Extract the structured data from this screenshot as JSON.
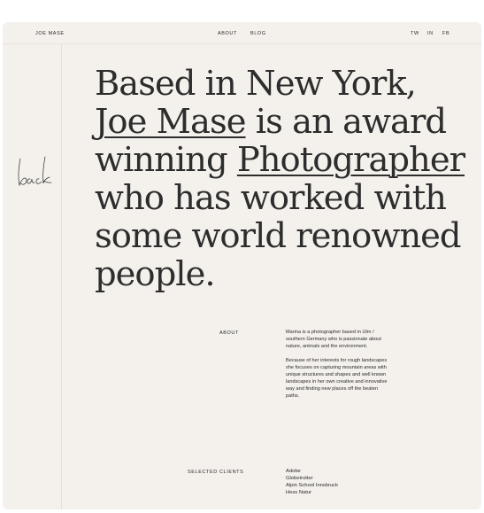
{
  "header": {
    "brand": "JOE MASE",
    "nav": {
      "about": "ABOUT",
      "blog": "BLOG"
    },
    "social": {
      "tw": "TW",
      "in": "IN",
      "fb": "FB"
    }
  },
  "sidebar": {
    "back_label": "back"
  },
  "hero": {
    "line1": "Based in New York,",
    "name": "Joe Mase",
    "line2_rest": " is an award",
    "line3_pre": "winning ",
    "profession": "Photographer",
    "line4": "who has worked with",
    "line5": "some world renowned",
    "line6": "people."
  },
  "about": {
    "label": "ABOUT",
    "paragraph1": "Marina is a photographer based in Ulm / southern Germany who is passionate about nature, animals and the environment.",
    "paragraph2": "Because of her interests for rough landscapes she focuses on capturing mountain areas with unique structures and shapes and well known landscapes in her own creative and innovative way and finding new places off the beaten paths."
  },
  "clients": {
    "label": "SELECTED CLIENTS",
    "items": [
      "Adobe",
      "Globetrotter",
      "Alpin School Innsbruck",
      "Hess Natur"
    ]
  },
  "colors": {
    "background": "#f4f1ed",
    "text": "#2d2d2d",
    "rule": "#e6e1db"
  }
}
